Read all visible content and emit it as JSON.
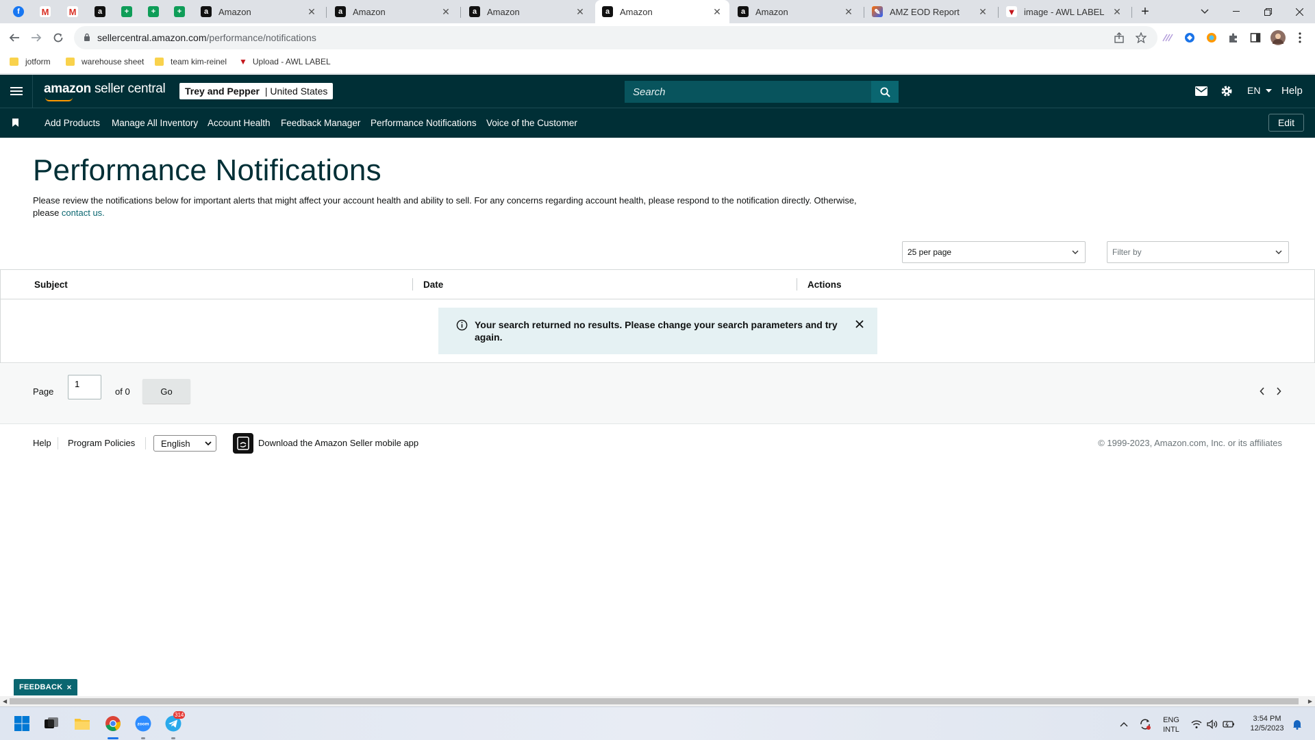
{
  "browser": {
    "tabs": [
      {
        "title": "Amazon",
        "favicon": "amazon-icon",
        "active": false
      },
      {
        "title": "Amazon",
        "favicon": "amazon-icon",
        "active": false
      },
      {
        "title": "Amazon",
        "favicon": "amazon-icon",
        "active": false
      },
      {
        "title": "Amazon",
        "favicon": "amazon-icon",
        "active": true
      },
      {
        "title": "Amazon",
        "favicon": "amazon-icon",
        "active": false
      },
      {
        "title": "AMZ EOD Report",
        "favicon": "edit-icon",
        "active": false
      },
      {
        "title": "image - AWL LABEL",
        "favicon": "awl-icon",
        "active": false
      }
    ],
    "new_tab_label": "+",
    "url_host": "sellercentral.amazon.com",
    "url_path": "/performance/notifications",
    "bookmarks": [
      "jotform",
      "warehouse sheet",
      "team kim-reinel",
      "Upload - AWL LABEL"
    ]
  },
  "header": {
    "logo_brand": "amazon",
    "logo_product": "seller central",
    "account_name": "Trey and Pepper",
    "account_separator": " | ",
    "account_region": "United States",
    "search_placeholder": "Search",
    "language": "EN",
    "help": "Help"
  },
  "nav": {
    "links": [
      "Add Products",
      "Manage All Inventory",
      "Account Health",
      "Feedback Manager",
      "Performance Notifications",
      "Voice of the Customer"
    ],
    "edit": "Edit"
  },
  "main": {
    "title": "Performance Notifications",
    "description": "Please review the notifications below for important alerts that might affect your account health and ability to sell. For any concerns regarding account health, please respond to the notification directly. Otherwise, please ",
    "contact_link": "contact us.",
    "per_page": "25 per page",
    "filter_placeholder": "Filter by",
    "columns": [
      "Subject",
      "Date",
      "Actions"
    ],
    "no_results": "Your search returned no results. Please change your search parameters and try again.",
    "pagination": {
      "page_label": "Page",
      "page_value": "1",
      "of_label": "of 0",
      "go": "Go"
    }
  },
  "footer": {
    "help": "Help",
    "policies": "Program Policies",
    "language": "English",
    "app_text": "Download the Amazon Seller mobile app",
    "copyright": "© 1999-2023, Amazon.com, Inc. or its affiliates"
  },
  "feedback": {
    "label": "FEEDBACK",
    "close": "×"
  },
  "taskbar": {
    "lang_top": "ENG",
    "lang_bottom": "INTL",
    "time": "3:54 PM",
    "date": "12/5/2023",
    "telegram_badge": "314"
  },
  "colors": {
    "header_bg": "#002f36",
    "accent": "#0a6670",
    "info_bg": "#e5f1f3",
    "brand_orange": "#ff9900"
  }
}
